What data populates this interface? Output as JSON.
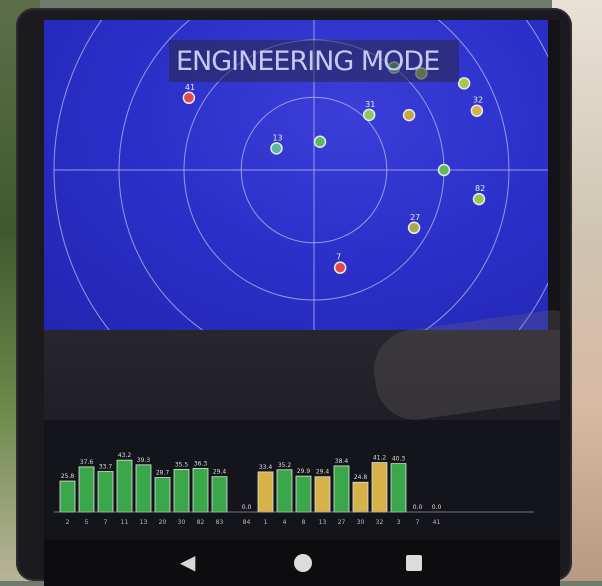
{
  "header": {
    "title": "ENGINEERING MODE"
  },
  "radar": {
    "satellites": [
      {
        "id": "",
        "color": "#59b864",
        "az": 12,
        "el": 80
      },
      {
        "id": "31",
        "color": "#8cc85c",
        "az": 45,
        "el": 63
      },
      {
        "id": "",
        "color": "#59b864",
        "az": 38,
        "el": 45
      },
      {
        "id": "",
        "color": "#a8c84c",
        "az": 48,
        "el": 40
      },
      {
        "id": "",
        "color": "#a8c84c",
        "az": 60,
        "el": 30
      },
      {
        "id": "32",
        "color": "#d6b248",
        "az": 70,
        "el": 30
      },
      {
        "id": "",
        "color": "#caa83e",
        "az": 60,
        "el": 52
      },
      {
        "id": "",
        "color": "#5dbb59",
        "az": 90,
        "el": 45
      },
      {
        "id": "41",
        "color": "#e04a4a",
        "az": 300,
        "el": 40
      },
      {
        "id": "13",
        "color": "#59b8a0",
        "az": 300,
        "el": 75
      },
      {
        "id": "27",
        "color": "#a8a84c",
        "az": 120,
        "el": 50
      },
      {
        "id": "82",
        "color": "#9ac84c",
        "az": 100,
        "el": 32
      },
      {
        "id": "7",
        "color": "#e04a4a",
        "az": 165,
        "el": 55
      }
    ]
  },
  "chart_data": {
    "type": "bar",
    "groups": [
      {
        "name": "",
        "color": "#3aa84a",
        "categories": [
          "2",
          "5",
          "7",
          "11",
          "13",
          "20",
          "30",
          "82",
          "83"
        ],
        "values": [
          25.8,
          37.6,
          33.7,
          43.2,
          39.3,
          28.7,
          35.5,
          36.3,
          29.4
        ]
      },
      {
        "name": "",
        "color": "#d6b248",
        "categories": [
          "84",
          "1",
          "4",
          "8",
          "13",
          "27",
          "30",
          "32",
          "3",
          "7",
          "41"
        ],
        "values": [
          0.0,
          33.4,
          35.2,
          29.9,
          29.4,
          38.4,
          24.8,
          41.2,
          40.3,
          0.0,
          0.0
        ],
        "series_colors": [
          "#d6b248",
          "#d6b248",
          "#3aa84a",
          "#3aa84a",
          "#d6b248",
          "#3aa84a",
          "#d6b248",
          "#d6b248",
          "#3aa84a",
          "#d6b248",
          "#d6b248"
        ]
      }
    ],
    "value_labels": [
      "25.8",
      "37.6",
      "33.7",
      "43.2",
      "39.3",
      "28.7",
      "35.5",
      "36.3",
      "29.4",
      "0.0",
      "33.4",
      "35.2",
      "29.9",
      "29.4",
      "38.4",
      "24.8",
      "41.2",
      "40.3",
      "0.0",
      "0.0"
    ],
    "ylim": [
      0,
      50
    ]
  },
  "nav": {
    "back": "◀",
    "home": "",
    "recent": ""
  }
}
